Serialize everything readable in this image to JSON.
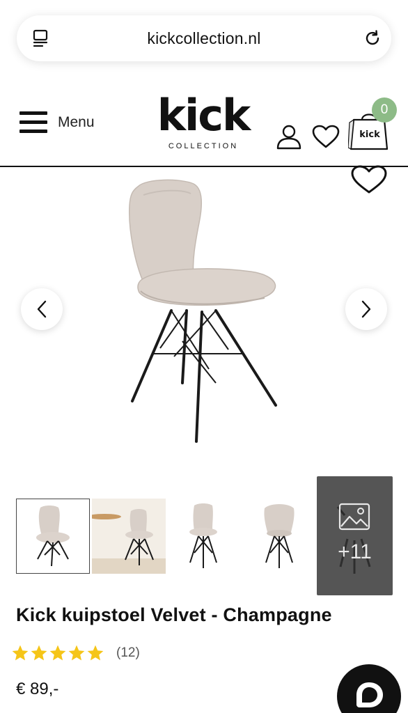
{
  "browser": {
    "url": "kickcollection.nl"
  },
  "header": {
    "menu_label": "Menu",
    "logo": {
      "name": "kick",
      "subtitle": "COLLECTION"
    },
    "cart": {
      "count": "0",
      "bag_label": "kick"
    }
  },
  "gallery": {
    "more_images": "+11",
    "thumbnails": [
      "front-view",
      "lifestyle-view",
      "front-view-small",
      "back-view"
    ]
  },
  "product": {
    "title": "Kick kuipstoel Velvet - Champagne",
    "rating_stars": 5,
    "review_count": "(12)",
    "price": "€ 89,-"
  },
  "colors": {
    "accent_badge": "#8dbb87",
    "star": "#f5c518",
    "chair_fabric": "#d8cfc8",
    "chair_legs": "#1a1a1a"
  }
}
